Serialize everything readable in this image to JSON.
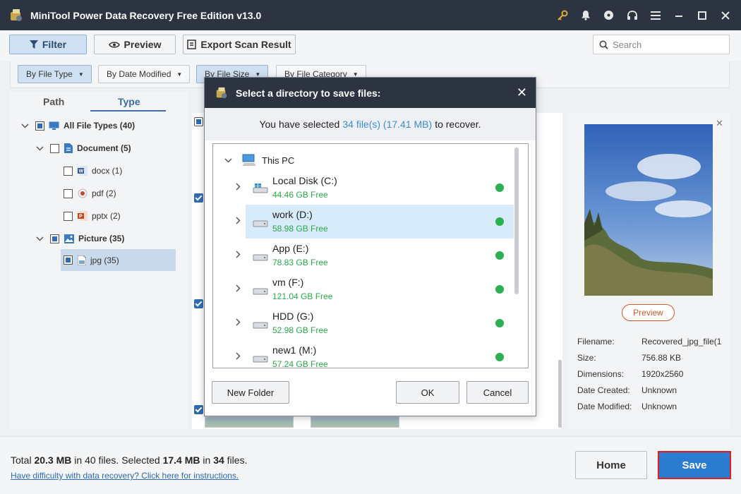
{
  "app": {
    "title": "MiniTool Power Data Recovery Free Edition v13.0"
  },
  "titlebar_icons": [
    "key-icon",
    "bell-icon",
    "disc-icon",
    "headset-icon",
    "menu-icon",
    "minimize-icon",
    "maximize-icon",
    "close-icon"
  ],
  "toolbar": {
    "filter_label": "Filter",
    "preview_label": "Preview",
    "export_label": "Export Scan Result",
    "search_placeholder": "Search"
  },
  "filters": [
    {
      "label": "By File Type",
      "active": true
    },
    {
      "label": "By Date Modified",
      "active": false
    },
    {
      "label": "By File Size",
      "active": true
    },
    {
      "label": "By File Category",
      "active": false
    }
  ],
  "left_tabs": {
    "path": "Path",
    "type": "Type"
  },
  "tree": [
    {
      "label": "All File Types (40)",
      "bold": true,
      "level": 0
    },
    {
      "label": "Document (5)",
      "bold": true,
      "level": 1
    },
    {
      "label": "docx (1)",
      "bold": false,
      "level": 2
    },
    {
      "label": "pdf (2)",
      "bold": false,
      "level": 2
    },
    {
      "label": "pptx (2)",
      "bold": false,
      "level": 2
    },
    {
      "label": "Picture (35)",
      "bold": true,
      "level": 1
    },
    {
      "label": "jpg (35)",
      "bold": false,
      "level": 2
    }
  ],
  "preview": {
    "button_label": "Preview",
    "labels": [
      "Filename:",
      "Size:",
      "Dimensions:",
      "Date Created:",
      "Date Modified:"
    ],
    "values": [
      "Recovered_jpg_file(1",
      "756.88 KB",
      "1920x2560",
      "Unknown",
      "Unknown"
    ]
  },
  "footer": {
    "total_prefix": "Total",
    "total_size": "20.3 MB",
    "total_mid": "in 40 files.",
    "selected_prefix": "Selected",
    "selected_size": "17.4 MB",
    "selected_mid": "in",
    "selected_count": "34",
    "selected_suffix": "files.",
    "help_link": "Have difficulty with data recovery? Click here for instructions.",
    "home_label": "Home",
    "save_label": "Save"
  },
  "dialog": {
    "title": "Select a directory to save files:",
    "info_prefix": "You have selected",
    "info_highlight": "34 file(s) (17.41 MB)",
    "info_suffix": "to recover.",
    "root_label": "This PC",
    "drives": [
      {
        "name": "Local Disk (C:)",
        "free": "44.46 GB Free",
        "selected": false
      },
      {
        "name": "work (D:)",
        "free": "58.98 GB Free",
        "selected": true
      },
      {
        "name": "App (E:)",
        "free": "78.83 GB Free",
        "selected": false
      },
      {
        "name": "vm (F:)",
        "free": "121.04 GB Free",
        "selected": false
      },
      {
        "name": "HDD (G:)",
        "free": "52.98 GB Free",
        "selected": false
      },
      {
        "name": "new1 (M:)",
        "free": "57.24 GB Free",
        "selected": false
      }
    ],
    "new_folder_label": "New Folder",
    "ok_label": "OK",
    "cancel_label": "Cancel"
  },
  "colors": {
    "titlebar": "#2b3440",
    "accent": "#2b7cd0",
    "free_space": "#2aa84a",
    "highlight_text": "#3a8fd6"
  }
}
